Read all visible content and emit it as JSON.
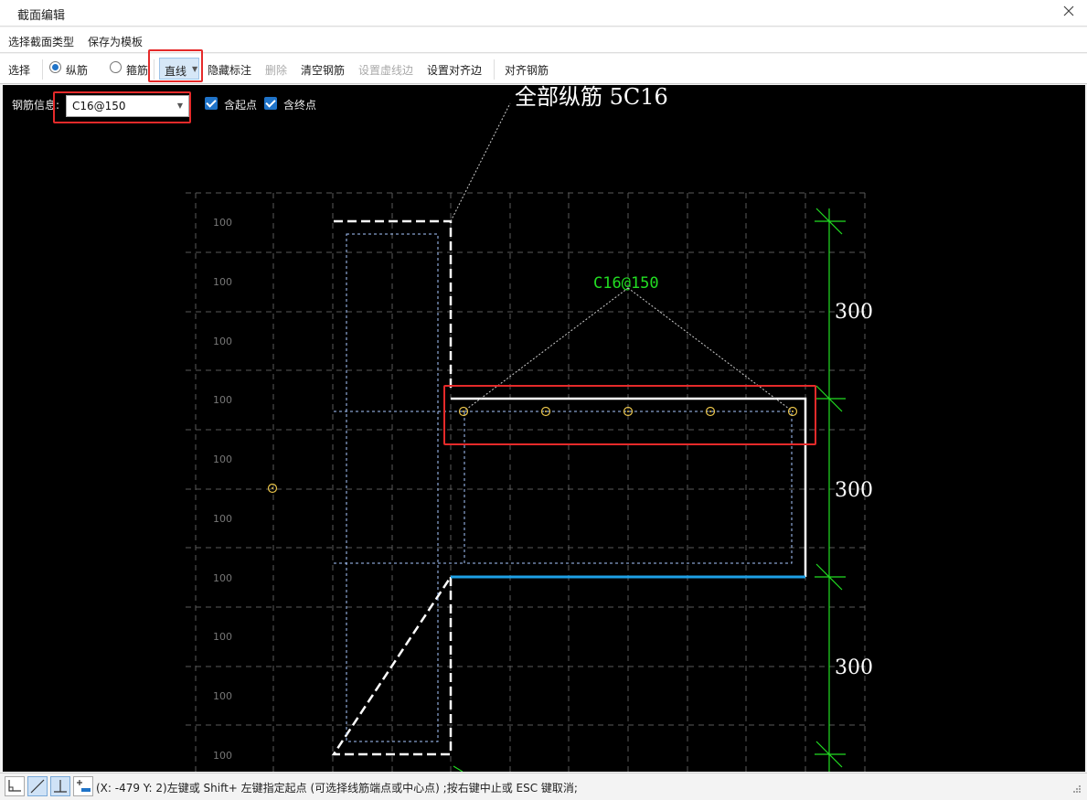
{
  "window": {
    "title": "截面编辑"
  },
  "menu": {
    "select_section_type": "选择截面类型",
    "save_as_template": "保存为模板"
  },
  "toolbar": {
    "select": "选择",
    "longitudinal": "纵筋",
    "stirrup": "箍筋",
    "line": "直线",
    "hide_labels": "隐藏标注",
    "delete": "删除",
    "clear_rebar": "清空钢筋",
    "set_dashed_edge": "设置虚线边",
    "set_align_edge": "设置对齐边",
    "align_rebar": "对齐钢筋"
  },
  "rebar_panel": {
    "label": "钢筋信息:",
    "value": "C16@150",
    "include_start": "含起点",
    "include_end": "含终点"
  },
  "drawing": {
    "all_longitudinal_label": "全部纵筋 5C16",
    "rebar_spec_label": "C16@150",
    "grid_labels": [
      "100",
      "100",
      "100",
      "100",
      "100",
      "100",
      "100",
      "100",
      "100",
      "100"
    ],
    "dimensions": [
      "300",
      "300",
      "300"
    ],
    "colors": {
      "dimension": "#22dd22",
      "edge_highlight": "#1ea0e6",
      "rebar_point": "#e8c34a"
    }
  },
  "status": {
    "message": "(X: -479 Y: 2)左键或 Shift+ 左键指定起点 (可选择线筋端点或中心点) ;按右键中止或 ESC 键取消;"
  }
}
